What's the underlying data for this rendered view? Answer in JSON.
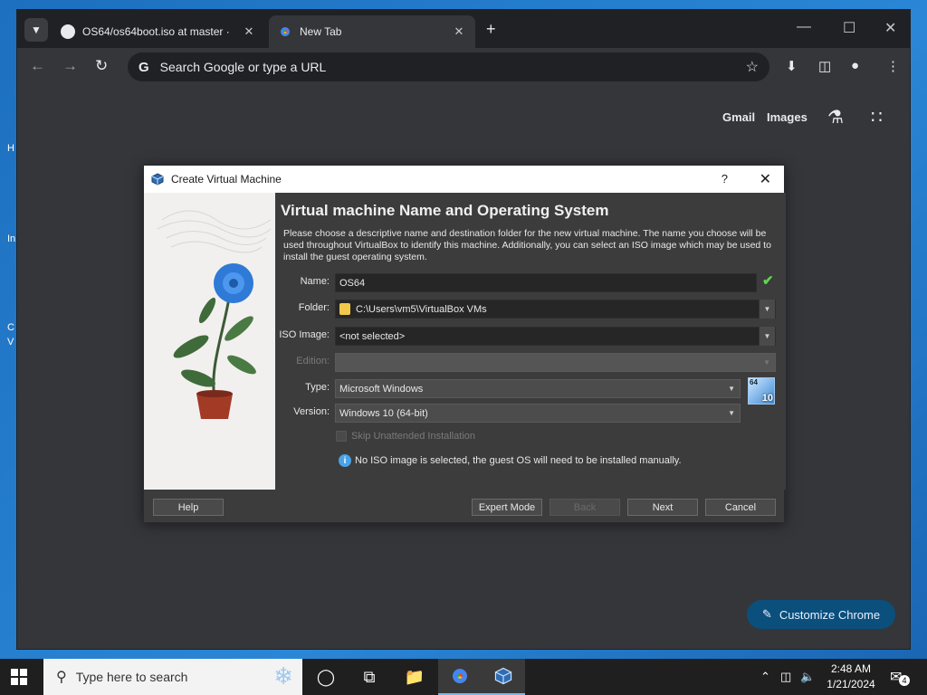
{
  "desktop": {
    "labels": [
      "H",
      "In",
      "C",
      "V"
    ]
  },
  "browser": {
    "tabs": [
      {
        "title": "OS64/os64boot.iso at master · ",
        "active": false,
        "icon": "github-icon"
      },
      {
        "title": "New Tab",
        "active": true,
        "icon": "chrome-icon"
      }
    ],
    "omnibox_placeholder": "Search Google or type a URL",
    "ntp": {
      "links": [
        "Gmail",
        "Images"
      ],
      "customize_label": "Customize Chrome"
    }
  },
  "dialog": {
    "title": "Create Virtual Machine",
    "help_glyph": "?",
    "heading": "Virtual machine Name and Operating System",
    "description": "Please choose a descriptive name and destination folder for the new virtual machine. The name you choose will be used throughout VirtualBox to identify this machine. Additionally, you can select an ISO image which may be used to install the guest operating system.",
    "labels": {
      "name": "Name:",
      "folder": "Folder:",
      "iso": "ISO Image:",
      "edition": "Edition:",
      "type": "Type:",
      "version": "Version:"
    },
    "values": {
      "name": "OS64",
      "folder": "C:\\Users\\vm5\\VirtualBox VMs",
      "iso": "<not selected>",
      "edition": "",
      "type": "Microsoft Windows",
      "version": "Windows 10 (64-bit)"
    },
    "os_badge": {
      "top": "64",
      "bottom": "10"
    },
    "skip_label": "Skip Unattended Installation",
    "note": "No ISO image is selected, the guest OS will need to be installed manually.",
    "buttons": {
      "help": "Help",
      "expert": "Expert Mode",
      "back": "Back",
      "next": "Next",
      "cancel": "Cancel"
    }
  },
  "taskbar": {
    "search_placeholder": "Type here to search",
    "time": "2:48 AM",
    "date": "1/21/2024",
    "notification_count": "4"
  },
  "colors": {
    "accent": "#0b4f7c",
    "dialog_bg": "#3c3c3c",
    "valid_check": "#5ed64f"
  }
}
